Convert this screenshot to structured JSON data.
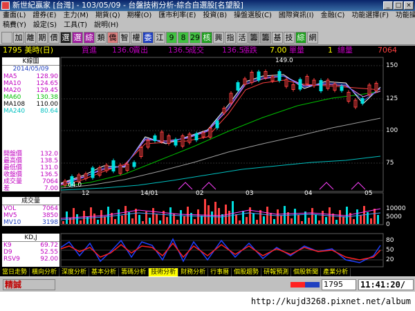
{
  "window": {
    "title": "新世紀贏家 [台灣] - 103/05/09 - 台盤技術分析-綜合自選股[名望股]",
    "minimize": "_",
    "maximize": "□",
    "close": "×"
  },
  "menu": {
    "row1": [
      "畫面(L)",
      "證券(E)",
      "主力(M)",
      "期貨(Q)",
      "期權(O)",
      "匯市利率(E)",
      "投資(B)",
      "操盤選股(C)",
      "國際資訊(I)",
      "金融(C)",
      "功能選擇(F)",
      "功能操作(F)"
    ],
    "row2": [
      "稿費(Y)",
      "設定(S)",
      "工具(T)",
      "說明(H)"
    ]
  },
  "toolbar": [
    {
      "t": "",
      "c": "#ffffff",
      "b": "#c0c0c0"
    },
    {
      "t": "加",
      "c": "#000",
      "b": "#c0c0c0"
    },
    {
      "t": "離",
      "c": "#000",
      "b": "#c0c0c0"
    },
    {
      "t": "期",
      "c": "#000",
      "b": "#c0c0c0"
    },
    {
      "t": "價",
      "c": "#000",
      "b": "#c0c0c0"
    },
    {
      "t": "選",
      "c": "#fff",
      "b": "#202020"
    },
    {
      "t": "選",
      "c": "#fff",
      "b": "#a020a0"
    },
    {
      "t": "綜",
      "c": "#fff",
      "b": "#a020a0"
    },
    {
      "t": "類",
      "c": "#000",
      "b": "#c0c0c0"
    },
    {
      "t": "僑",
      "c": "#000",
      "b": "#e08080"
    },
    {
      "t": "智",
      "c": "#000",
      "b": "#c0c0c0"
    },
    {
      "t": "權",
      "c": "#000",
      "b": "#c0c0c0"
    },
    {
      "t": "委",
      "c": "#fff",
      "b": "#2040c0"
    },
    {
      "t": "江",
      "c": "#000",
      "b": "#c0c0c0"
    },
    {
      "t": "9",
      "c": "#000",
      "b": "#40c040"
    },
    {
      "t": "8",
      "c": "#000",
      "b": "#40c040"
    },
    {
      "t": "29",
      "c": "#000",
      "b": "#40c040"
    },
    {
      "t": "核",
      "c": "#fff",
      "b": "#20a020"
    },
    {
      "t": "興",
      "c": "#000",
      "b": "#c0c0c0"
    },
    {
      "t": "指",
      "c": "#000",
      "b": "#c0c0c0"
    },
    {
      "t": "活",
      "c": "#000",
      "b": "#c0c0c0"
    },
    {
      "t": "籌",
      "c": "#000",
      "b": "#a0a0a0"
    },
    {
      "t": "籌",
      "c": "#000",
      "b": "#a0a0a0"
    },
    {
      "t": "基",
      "c": "#000",
      "b": "#c0c0c0"
    },
    {
      "t": "技",
      "c": "#000",
      "b": "#c0c0c0"
    },
    {
      "t": "綜",
      "c": "#fff",
      "b": "#20a020"
    },
    {
      "t": "網",
      "c": "#000",
      "b": "#c0c0c0"
    }
  ],
  "info": {
    "stock": "1795 美時(日)",
    "buy_label": "買進",
    "buy": "136.0",
    "sell_label": "賣出",
    "sell": "136.5",
    "deal_label": "成交",
    "deal": "136.5",
    "change_label": "漲跌",
    "change": "7.00",
    "unit_label": "單量",
    "unit": "1",
    "vol_label": "總量",
    "vol": "7064"
  },
  "panel": {
    "header": "K線圖",
    "date": "2014/05/09",
    "ma": [
      {
        "l": "MA5",
        "v": "128.90",
        "c": "#c000c0"
      },
      {
        "l": "MA10",
        "v": "124.65",
        "c": "#c000c0"
      },
      {
        "l": "MA20",
        "v": "129.45",
        "c": "#c000c0"
      },
      {
        "l": "MA60",
        "v": "130.38",
        "c": "#00c000"
      },
      {
        "l": "MA108",
        "v": "110.00",
        "c": "#000000"
      },
      {
        "l": "MA240",
        "v": "80.64",
        "c": "#00c0c0"
      }
    ],
    "ohlc": [
      {
        "l": "開盤價",
        "v": "132.0"
      },
      {
        "l": "最高價",
        "v": "138.5"
      },
      {
        "l": "最低價",
        "v": "131.0"
      },
      {
        "l": "收盤價",
        "v": "136.5"
      },
      {
        "l": "成交量",
        "v": "7064"
      },
      {
        "l": "差",
        "v": "7.00"
      }
    ]
  },
  "vol_panel": {
    "header": "成交量",
    "items": [
      {
        "l": "VOL",
        "v": "7064",
        "c": "#c000c0"
      },
      {
        "l": "MV5",
        "v": "3850",
        "c": "#c000c0"
      },
      {
        "l": "MV10",
        "v": "3198",
        "c": "#2040c0"
      }
    ]
  },
  "kd_panel": {
    "header": "KD,J",
    "items": [
      {
        "l": "K9",
        "v": "69.72",
        "c": "#c000c0"
      },
      {
        "l": "D9",
        "v": "52.55",
        "c": "#c000c0"
      },
      {
        "l": "RSV9",
        "v": "92.00",
        "c": "#c000c0"
      }
    ]
  },
  "price_axis": [
    "150",
    "125",
    "100",
    "75"
  ],
  "high_label": "149.0",
  "low_label": "64.0",
  "x_axis": [
    "12",
    "14/01",
    "02",
    "03",
    "04",
    "05"
  ],
  "vol_axis": [
    "10000",
    "5000",
    "0"
  ],
  "kd_axis": [
    "80",
    "50",
    "20"
  ],
  "tabs": [
    "當日走勢",
    "橫向分析",
    "深度分析",
    "基本分析",
    "籌碼分析",
    "技術分析",
    "財務分析",
    "行事曆",
    "個股趨勢",
    "研報預測",
    "個股新聞",
    "產業分析"
  ],
  "active_tab": 5,
  "status": {
    "left": "精誠",
    "code": "1795",
    "time": "11:41:20/"
  },
  "url": "http://kujd3268.pixnet.net/album"
}
